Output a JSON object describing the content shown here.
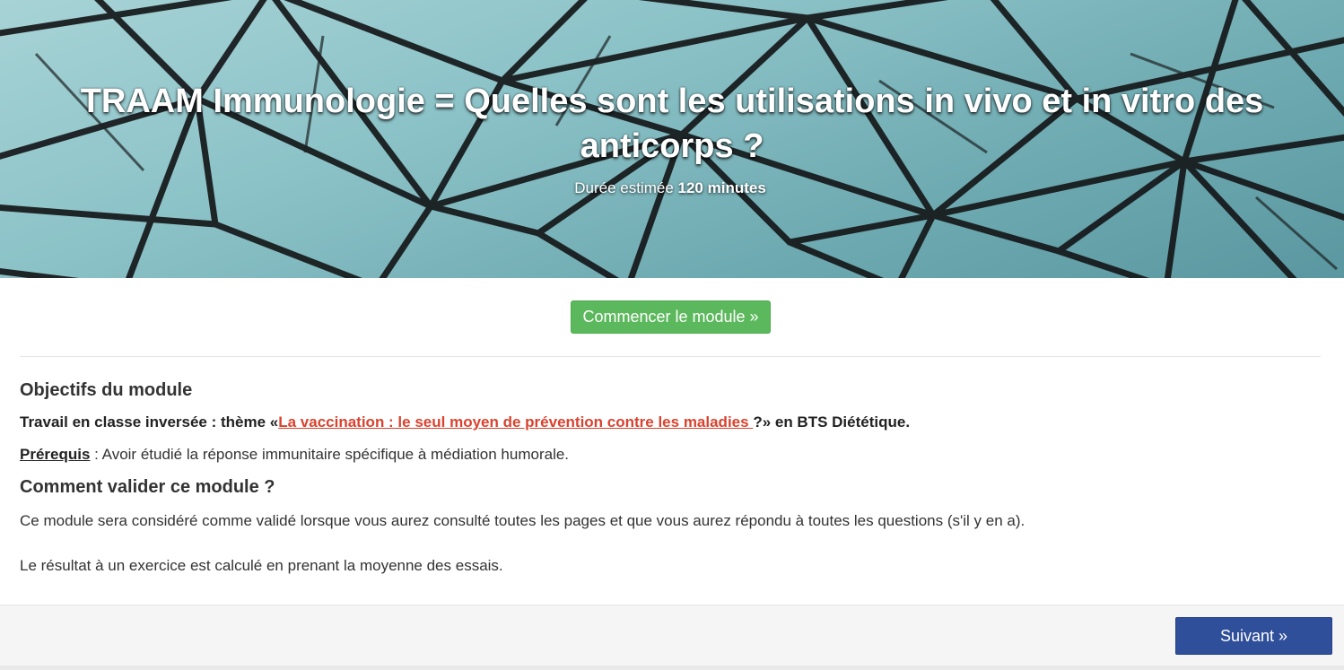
{
  "hero": {
    "title": "TRAAM Immunologie = Quelles sont les utilisations in vivo et in vitro des anticorps ?",
    "duration_prefix": "Durée estimée",
    "duration_value": "120 minutes"
  },
  "actions": {
    "start_label": "Commencer le module »",
    "next_label": "Suivant »"
  },
  "objectives": {
    "heading": "Objectifs du module",
    "line_prefix": "Travail en classe inversée : thème «",
    "link_text": "La vaccination : le seul moyen de prévention contre les maladies ",
    "line_suffix": "?» en BTS Diététique.",
    "prereq_label": "Prérequis",
    "prereq_text": " : Avoir étudié la réponse immunitaire spécifique à médiation humorale."
  },
  "validation": {
    "heading": "Comment valider ce module ?",
    "p1": "Ce module sera considéré comme validé lorsque vous aurez consulté toutes les pages et que vous aurez répondu à toutes les questions (s'il y en a).",
    "p2": "Le résultat à un exercice est calculé en prenant la moyenne des essais."
  },
  "colors": {
    "start_button": "#5cb85c",
    "next_button": "#2f4f9a",
    "link": "#d9432f"
  }
}
